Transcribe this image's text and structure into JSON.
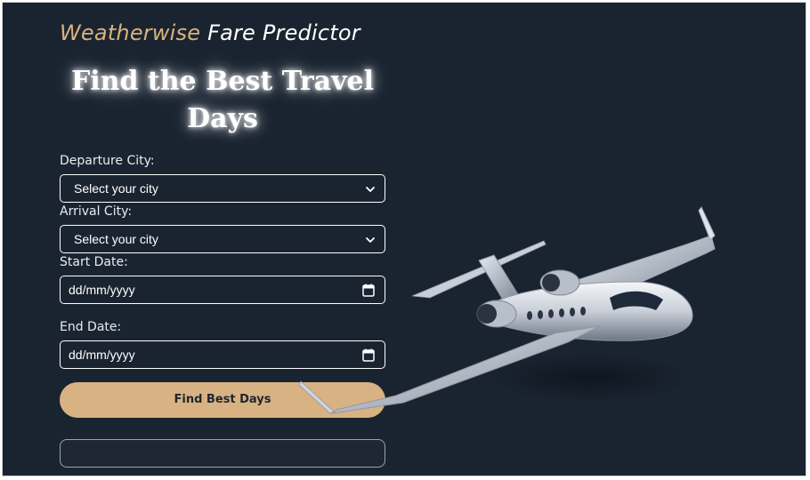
{
  "brand": {
    "part1": "Weatherwise",
    "part2": "Fare Predictor"
  },
  "hero": {
    "line1": "Find the Best Travel",
    "line2": "Days"
  },
  "form": {
    "departure_label": "Departure City:",
    "departure_value": "Select your city",
    "arrival_label": "Arrival City:",
    "arrival_value": "Select your city",
    "start_label": "Start Date:",
    "start_value": "dd/mm/yyyy",
    "end_label": "End Date:",
    "end_value": "dd/mm/yyyy",
    "submit_label": "Find Best Days"
  },
  "colors": {
    "background": "#1a2431",
    "accent": "#d8b282",
    "text": "#ffffff"
  },
  "icons": {
    "select": "chevron-down-icon",
    "date": "calendar-icon",
    "hero_image": "private-jet-image"
  }
}
